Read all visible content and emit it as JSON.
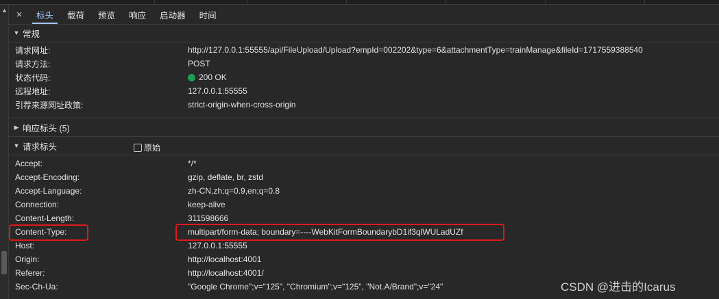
{
  "tabs": {
    "close_icon": "×",
    "items": [
      "标头",
      "载荷",
      "预览",
      "响应",
      "启动器",
      "时间"
    ],
    "active": "标头"
  },
  "general": {
    "title": "常规",
    "rows": [
      {
        "key": "请求网址:",
        "value": "http://127.0.0.1:55555/api/FileUpload/Upload?empId=002202&type=6&attachmentType=trainManage&fileId=1717559388540"
      },
      {
        "key": "请求方法:",
        "value": "POST"
      },
      {
        "key": "状态代码:",
        "value": "200 OK"
      },
      {
        "key": "远程地址:",
        "value": "127.0.0.1:55555"
      },
      {
        "key": "引荐来源网址政策:",
        "value": "strict-origin-when-cross-origin"
      }
    ]
  },
  "response_headers": {
    "title": "响应标头 (5)"
  },
  "request_headers": {
    "title": "请求标头",
    "raw_label": "原始",
    "rows": [
      {
        "key": "Accept:",
        "value": "*/*"
      },
      {
        "key": "Accept-Encoding:",
        "value": "gzip, deflate, br, zstd"
      },
      {
        "key": "Accept-Language:",
        "value": "zh-CN,zh;q=0.9,en;q=0.8"
      },
      {
        "key": "Connection:",
        "value": "keep-alive"
      },
      {
        "key": "Content-Length:",
        "value": "311598666"
      },
      {
        "key": "Content-Type:",
        "value": "multipart/form-data; boundary=----WebKitFormBoundarybD1if3qlWULadUZf"
      },
      {
        "key": "Host:",
        "value": "127.0.0.1:55555"
      },
      {
        "key": "Origin:",
        "value": "http://localhost:4001"
      },
      {
        "key": "Referer:",
        "value": "http://localhost:4001/"
      },
      {
        "key": "Sec-Ch-Ua:",
        "value": "\"Google Chrome\";v=\"125\", \"Chromium\";v=\"125\", \"Not.A/Brand\";v=\"24\""
      }
    ]
  },
  "watermark": "CSDN @进击的Icarus",
  "colors": {
    "status_ok": "#1f9d55",
    "highlight": "#e0181b",
    "active_tab": "#a8c7fa"
  }
}
